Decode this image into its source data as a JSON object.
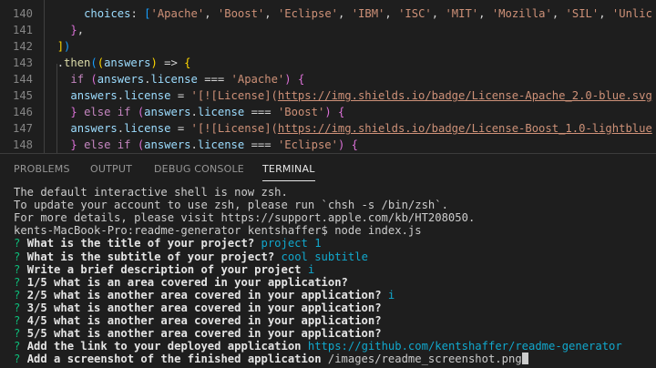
{
  "editor": {
    "lines": [
      {
        "num": "140",
        "indent": 6,
        "segments": [
          {
            "t": "choices",
            "c": "prop"
          },
          {
            "t": ": ",
            "c": "punc"
          },
          {
            "t": "[",
            "c": "br3"
          },
          {
            "t": "'Apache'",
            "c": "str"
          },
          {
            "t": ", ",
            "c": "punc"
          },
          {
            "t": "'Boost'",
            "c": "str"
          },
          {
            "t": ", ",
            "c": "punc"
          },
          {
            "t": "'Eclipse'",
            "c": "str"
          },
          {
            "t": ", ",
            "c": "punc"
          },
          {
            "t": "'IBM'",
            "c": "str"
          },
          {
            "t": ", ",
            "c": "punc"
          },
          {
            "t": "'ISC'",
            "c": "str"
          },
          {
            "t": ", ",
            "c": "punc"
          },
          {
            "t": "'MIT'",
            "c": "str"
          },
          {
            "t": ", ",
            "c": "punc"
          },
          {
            "t": "'Mozilla'",
            "c": "str"
          },
          {
            "t": ", ",
            "c": "punc"
          },
          {
            "t": "'SIL'",
            "c": "str"
          },
          {
            "t": ", ",
            "c": "punc"
          },
          {
            "t": "'Unlic",
            "c": "str"
          }
        ]
      },
      {
        "num": "141",
        "indent": 4,
        "segments": [
          {
            "t": "}",
            "c": "br2"
          },
          {
            "t": ",",
            "c": "punc"
          }
        ]
      },
      {
        "num": "142",
        "indent": 2,
        "segments": [
          {
            "t": "]",
            "c": "br1"
          },
          {
            "t": ")",
            "c": "br3"
          }
        ]
      },
      {
        "num": "143",
        "indent": 2,
        "segments": [
          {
            "t": ".",
            "c": "punc"
          },
          {
            "t": "then",
            "c": "fn"
          },
          {
            "t": "(",
            "c": "br3"
          },
          {
            "t": "(",
            "c": "br1"
          },
          {
            "t": "answers",
            "c": "prop"
          },
          {
            "t": ")",
            "c": "br1"
          },
          {
            "t": " => ",
            "c": "op"
          },
          {
            "t": "{",
            "c": "br1"
          }
        ]
      },
      {
        "num": "144",
        "indent": 4,
        "segments": [
          {
            "t": "if",
            "c": "kw"
          },
          {
            "t": " ",
            "c": "punc"
          },
          {
            "t": "(",
            "c": "br2"
          },
          {
            "t": "answers",
            "c": "prop"
          },
          {
            "t": ".",
            "c": "punc"
          },
          {
            "t": "license",
            "c": "prop"
          },
          {
            "t": " === ",
            "c": "op"
          },
          {
            "t": "'Apache'",
            "c": "str"
          },
          {
            "t": ")",
            "c": "br2"
          },
          {
            "t": " ",
            "c": "punc"
          },
          {
            "t": "{",
            "c": "br2"
          }
        ]
      },
      {
        "num": "145",
        "indent": 4,
        "segments": [
          {
            "t": "answers",
            "c": "prop"
          },
          {
            "t": ".",
            "c": "punc"
          },
          {
            "t": "license",
            "c": "prop"
          },
          {
            "t": " = ",
            "c": "op"
          },
          {
            "t": "'[![License](",
            "c": "str"
          },
          {
            "t": "https://img.shields.io/badge/License-Apache_2.0-blue.svg",
            "c": "link"
          }
        ]
      },
      {
        "num": "146",
        "indent": 4,
        "segments": [
          {
            "t": "}",
            "c": "br2"
          },
          {
            "t": " ",
            "c": "punc"
          },
          {
            "t": "else",
            "c": "kw"
          },
          {
            "t": " ",
            "c": "punc"
          },
          {
            "t": "if",
            "c": "kw"
          },
          {
            "t": " ",
            "c": "punc"
          },
          {
            "t": "(",
            "c": "br2"
          },
          {
            "t": "answers",
            "c": "prop"
          },
          {
            "t": ".",
            "c": "punc"
          },
          {
            "t": "license",
            "c": "prop"
          },
          {
            "t": " === ",
            "c": "op"
          },
          {
            "t": "'Boost'",
            "c": "str"
          },
          {
            "t": ")",
            "c": "br2"
          },
          {
            "t": " ",
            "c": "punc"
          },
          {
            "t": "{",
            "c": "br2"
          }
        ]
      },
      {
        "num": "147",
        "indent": 4,
        "segments": [
          {
            "t": "answers",
            "c": "prop"
          },
          {
            "t": ".",
            "c": "punc"
          },
          {
            "t": "license",
            "c": "prop"
          },
          {
            "t": " = ",
            "c": "op"
          },
          {
            "t": "'[![License](",
            "c": "str"
          },
          {
            "t": "https://img.shields.io/badge/License-Boost_1.0-lightblue",
            "c": "link"
          }
        ]
      },
      {
        "num": "148",
        "indent": 4,
        "segments": [
          {
            "t": "}",
            "c": "br2"
          },
          {
            "t": " ",
            "c": "punc"
          },
          {
            "t": "else",
            "c": "kw"
          },
          {
            "t": " ",
            "c": "punc"
          },
          {
            "t": "if",
            "c": "kw"
          },
          {
            "t": " ",
            "c": "punc"
          },
          {
            "t": "(",
            "c": "br2"
          },
          {
            "t": "answers",
            "c": "prop"
          },
          {
            "t": ".",
            "c": "punc"
          },
          {
            "t": "license",
            "c": "prop"
          },
          {
            "t": " === ",
            "c": "op"
          },
          {
            "t": "'Eclipse'",
            "c": "str"
          },
          {
            "t": ")",
            "c": "br2"
          },
          {
            "t": " ",
            "c": "punc"
          },
          {
            "t": "{",
            "c": "br2"
          }
        ]
      }
    ]
  },
  "panel": {
    "tabs": [
      {
        "label": "PROBLEMS",
        "active": false
      },
      {
        "label": "OUTPUT",
        "active": false
      },
      {
        "label": "DEBUG CONSOLE",
        "active": false
      },
      {
        "label": "TERMINAL",
        "active": true
      }
    ]
  },
  "terminal": {
    "lines": [
      {
        "type": "plain",
        "text": "The default interactive shell is now zsh."
      },
      {
        "type": "plain",
        "text": "To update your account to use zsh, please run `chsh -s /bin/zsh`."
      },
      {
        "type": "plain",
        "text": "For more details, please visit https://support.apple.com/kb/HT208050."
      },
      {
        "type": "plain",
        "text": "kents-MacBook-Pro:readme-generator kentshaffer$ node index.js"
      },
      {
        "type": "q",
        "mark": "? ",
        "question": "What is the title of your project? ",
        "answer": "project 1"
      },
      {
        "type": "q",
        "mark": "? ",
        "question": "What is the subtitle of your project? ",
        "answer": "cool subtitle"
      },
      {
        "type": "q",
        "mark": "? ",
        "question": "Write a brief description of your project ",
        "answer": "i"
      },
      {
        "type": "q",
        "mark": "? ",
        "question": "1/5 what is an area covered in your application?",
        "answer": ""
      },
      {
        "type": "q",
        "mark": "? ",
        "question": "2/5 what is another area covered in your application? ",
        "answer": "i"
      },
      {
        "type": "q",
        "mark": "? ",
        "question": "3/5 what is another area covered in your application?",
        "answer": ""
      },
      {
        "type": "q",
        "mark": "? ",
        "question": "4/5 what is another area covered in your application?",
        "answer": ""
      },
      {
        "type": "q",
        "mark": "? ",
        "question": "5/5 what is another area covered in your application?",
        "answer": ""
      },
      {
        "type": "q",
        "mark": "? ",
        "question": "Add the link to your deployed application ",
        "answer": "https://github.com/kentshaffer/readme-generator"
      },
      {
        "type": "input",
        "mark": "? ",
        "question": "Add a screenshot of the finished application ",
        "answer": "/images/readme_screenshot.png"
      }
    ]
  },
  "colors": {
    "background": "#1e1e1e",
    "question_mark": "#0dbc79",
    "answer": "#11a8cd",
    "string": "#ce9178",
    "property": "#9cdcfe",
    "keyword": "#c586c0"
  }
}
